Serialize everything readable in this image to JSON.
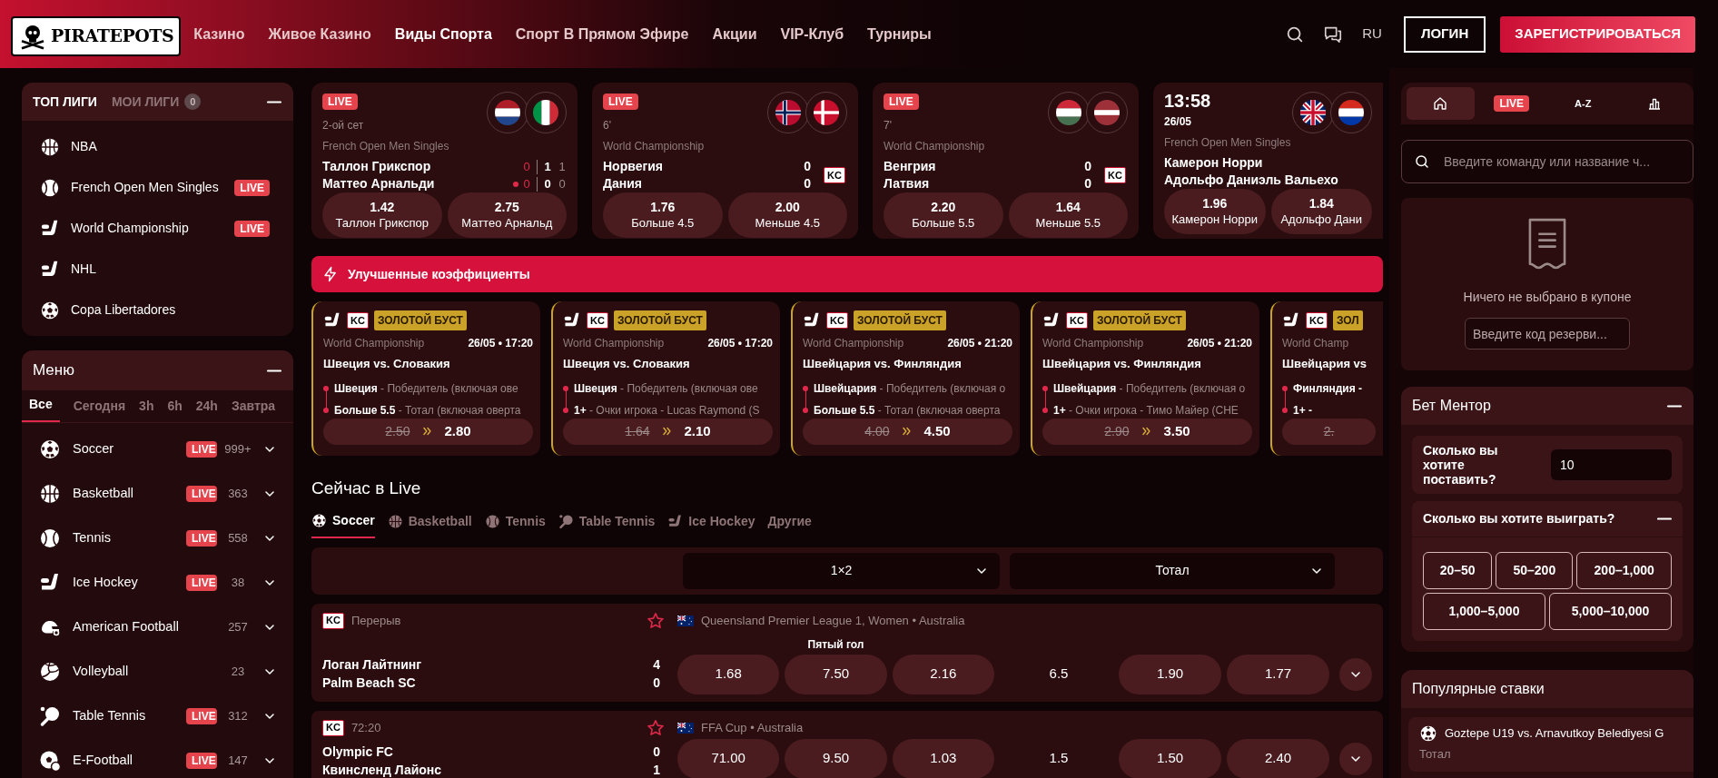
{
  "header": {
    "logo": "PIRATEPOTS",
    "nav": [
      {
        "label": "Казино",
        "selected": false
      },
      {
        "label": "Живое Казино",
        "selected": false
      },
      {
        "label": "Виды Спорта",
        "selected": true
      },
      {
        "label": "Спорт В Прямом Эфире",
        "selected": false
      },
      {
        "label": "Акции",
        "selected": false
      },
      {
        "label": "VIP-Клуб",
        "selected": false
      },
      {
        "label": "Турниры",
        "selected": false
      }
    ],
    "language": "RU",
    "login": "ЛОГИН",
    "register": "ЗАРЕГИСТРИРОВАТЬСЯ"
  },
  "top_leagues": {
    "tabs": [
      {
        "label": "ТОП ЛИГИ",
        "selected": true
      },
      {
        "label": "МОИ ЛИГИ",
        "selected": false,
        "count": "0"
      }
    ],
    "items": [
      {
        "kind": "basketball",
        "label": "NBA"
      },
      {
        "kind": "tennis",
        "label": "French Open Men Singles",
        "badge": "LIVE"
      },
      {
        "kind": "hockey",
        "label": "World Championship",
        "badge": "LIVE"
      },
      {
        "kind": "hockey",
        "label": "NHL"
      },
      {
        "kind": "soccer",
        "label": "Copa Libertadores"
      }
    ]
  },
  "menu": {
    "title": "Меню",
    "filters": [
      {
        "label": "Все",
        "selected": true
      },
      {
        "label": "Сегодня",
        "selected": false
      },
      {
        "label": "3h",
        "selected": false
      },
      {
        "label": "6h",
        "selected": false
      },
      {
        "label": "24h",
        "selected": false
      },
      {
        "label": "Завтра",
        "selected": false
      }
    ],
    "sports": [
      {
        "kind": "soccer",
        "label": "Soccer",
        "badge": "LIVE",
        "count": "999+"
      },
      {
        "kind": "basketball",
        "label": "Basketball",
        "badge": "LIVE",
        "count": "363"
      },
      {
        "kind": "tennis",
        "label": "Tennis",
        "badge": "LIVE",
        "count": "558"
      },
      {
        "kind": "hockey",
        "label": "Ice Hockey",
        "badge": "LIVE",
        "count": "38"
      },
      {
        "kind": "football",
        "label": "American Football",
        "count": "257"
      },
      {
        "kind": "volleyball",
        "label": "Volleyball",
        "count": "23"
      },
      {
        "kind": "tabletennis",
        "label": "Table Tennis",
        "badge": "LIVE",
        "count": "312"
      },
      {
        "kind": "efootball",
        "label": "E-Football",
        "badge": "LIVE",
        "count": "147"
      }
    ]
  },
  "featured_matches": [
    {
      "badge": "LIVE",
      "period": "2-ой сет",
      "league": "French Open Men Singles",
      "teams": [
        {
          "name": "Таллон Грикспор",
          "flag": {
            "kind": "netherlands"
          },
          "serving": false,
          "scores": [
            "0",
            "1",
            "1"
          ]
        },
        {
          "name": "Маттео Арнальди",
          "flag": {
            "kind": "italy"
          },
          "serving": true,
          "scores": [
            "0",
            "0",
            "0"
          ]
        }
      ],
      "odds": [
        {
          "value": "1.42",
          "label": "Таллон Грикспор"
        },
        {
          "value": "2.75",
          "label": "Маттео Арнальд"
        }
      ]
    },
    {
      "badge": "LIVE",
      "period": "6'",
      "league": "World Championship",
      "kc": "KC",
      "teams": [
        {
          "name": "Норвегия",
          "flag": {
            "kind": "norway"
          },
          "scores": [
            "0"
          ]
        },
        {
          "name": "Дания",
          "flag": {
            "kind": "denmark"
          },
          "scores": [
            "0"
          ]
        }
      ],
      "odds": [
        {
          "value": "1.76",
          "label": "Больше 4.5"
        },
        {
          "value": "2.00",
          "label": "Меньше 4.5"
        }
      ]
    },
    {
      "badge": "LIVE",
      "period": "7'",
      "league": "World Championship",
      "kc": "KC",
      "teams": [
        {
          "name": "Венгрия",
          "flag": {
            "kind": "hungary"
          },
          "scores": [
            "0"
          ]
        },
        {
          "name": "Латвия",
          "flag": {
            "kind": "latvia"
          },
          "scores": [
            "0"
          ]
        }
      ],
      "odds": [
        {
          "value": "2.20",
          "label": "Больше 5.5"
        },
        {
          "value": "1.64",
          "label": "Меньше 5.5"
        }
      ]
    },
    {
      "time": "13:58",
      "date": "26/05",
      "league": "French Open Men Singles",
      "teams": [
        {
          "name": "Камерон Норри",
          "flag": {
            "kind": "uk"
          }
        },
        {
          "name": "Адольфо Даниэль Вальехо",
          "flag": {
            "kind": "paraguay"
          }
        }
      ],
      "odds": [
        {
          "value": "1.96",
          "label": "Камерон Норри"
        },
        {
          "value": "1.84",
          "label": "Адольфо Дани"
        }
      ]
    }
  ],
  "boosted": {
    "title": "Улучшенные коэффициенты",
    "cards": [
      {
        "kind": "full",
        "kc": "KC",
        "tag": "ЗОЛОТОЙ БУСТ",
        "league": "World Championship",
        "datetime": "26/05 • 17:20",
        "match": "Швеция vs. Словакия",
        "legs": [
          {
            "pick": "Швеция",
            "market": "- Победитель (включая ове"
          },
          {
            "pick": "Больше 5.5",
            "market": "- Тотал (включая оверта"
          }
        ],
        "old_odds": "2.50",
        "new_odds": "2.80"
      },
      {
        "kind": "full",
        "kc": "KC",
        "tag": "ЗОЛОТОЙ БУСТ",
        "league": "World Championship",
        "datetime": "26/05 • 17:20",
        "match": "Швеция vs. Словакия",
        "legs": [
          {
            "pick": "Швеция",
            "market": "- Победитель (включая ове"
          },
          {
            "pick": "1+",
            "market": "- Очки игрока - Lucas Raymond (S"
          }
        ],
        "old_odds": "1.64",
        "new_odds": "2.10"
      },
      {
        "kind": "full",
        "kc": "KC",
        "tag": "ЗОЛОТОЙ БУСТ",
        "league": "World Championship",
        "datetime": "26/05 • 21:20",
        "match": "Швейцария vs. Финляндия",
        "legs": [
          {
            "pick": "Швейцария",
            "market": "- Победитель (включая о"
          },
          {
            "pick": "Больше 5.5",
            "market": "- Тотал (включая оверта"
          }
        ],
        "old_odds": "4.00",
        "new_odds": "4.50"
      },
      {
        "kind": "full",
        "kc": "KC",
        "tag": "ЗОЛОТОЙ БУСТ",
        "league": "World Championship",
        "datetime": "26/05 • 21:20",
        "match": "Швейцария vs. Финляндия",
        "legs": [
          {
            "pick": "Швейцария",
            "market": "- Победитель (включая о"
          },
          {
            "pick": "1+",
            "market": "- Очки игрока - Тимо Майер (CHE"
          }
        ],
        "old_odds": "2.90",
        "new_odds": "3.50"
      },
      {
        "kind": "partial",
        "kc": "KC",
        "tag": "ЗОЛ",
        "league": "World Champ",
        "match": "Швейцария vs",
        "legs": [
          {
            "pick": "Финляндия -"
          },
          {
            "pick": "1+ -"
          }
        ],
        "old_odds": "2."
      }
    ]
  },
  "live": {
    "title": "Сейчас в Live",
    "tabs": [
      {
        "kind": "soccer",
        "label": "Soccer",
        "selected": true
      },
      {
        "kind": "basketball",
        "label": "Basketball",
        "selected": false
      },
      {
        "kind": "tennis",
        "label": "Tennis",
        "selected": false
      },
      {
        "kind": "tabletennis",
        "label": "Table Tennis",
        "selected": false
      },
      {
        "kind": "hockey",
        "label": "Ice Hockey",
        "selected": false
      },
      {
        "label": "Другие",
        "selected": false
      }
    ],
    "markets": [
      "1×2",
      "Тотал"
    ],
    "events": [
      {
        "kc": "KC",
        "status": "Перерыв",
        "favorite": false,
        "flag": {
          "kind": "australia"
        },
        "league": "Queensland Premier League 1, Women • Australia",
        "market_label": "Пятый гол",
        "teams": [
          {
            "name": "Логан Лайтнинг",
            "score": "4"
          },
          {
            "name": "Palm Beach SC",
            "score": "0"
          }
        ],
        "odds_1x2": [
          "1.68",
          "7.50",
          "2.16"
        ],
        "total_line": "6.5",
        "odds_total": [
          "1.90",
          "1.77"
        ]
      },
      {
        "kc": "KC",
        "status": "72:20",
        "favorite": false,
        "flag": {
          "kind": "australia"
        },
        "league": "FFA Cup • Australia",
        "teams": [
          {
            "name": "Olympic FC",
            "score": "0"
          },
          {
            "name": "Квинсленд Лайонс",
            "score": "1"
          }
        ],
        "odds_1x2": [
          "71.00",
          "9.50",
          "1.03"
        ],
        "total_line": "1.5",
        "odds_total": [
          "1.50",
          "2.40"
        ]
      }
    ]
  },
  "betslip": {
    "tabs": [
      {
        "kind": "home",
        "selected": true
      },
      {
        "kind": "live",
        "label": "LIVE",
        "selected": false
      },
      {
        "kind": "az",
        "label": "A-Z",
        "selected": false
      },
      {
        "kind": "stats",
        "selected": false
      }
    ],
    "search_placeholder": "Введите команду или название ч...",
    "empty_text": "Ничего не выбрано в купоне",
    "code_placeholder": "Введите код резерви..."
  },
  "bet_mentor": {
    "title": "Бет Ментор",
    "stake_label": "Сколько вы хотите поставить?",
    "stake_value": "10",
    "win_label": "Сколько вы хотите выиграть?",
    "ranges": [
      "20–50",
      "50–200",
      "200–1,000",
      "1,000–5,000",
      "5,000–10,000"
    ]
  },
  "popular": {
    "title": "Популярные ставки",
    "items": [
      {
        "kind": "soccer",
        "match": "Goztepe U19 vs. Arnavutkoy Belediyesi G",
        "market": "Тотал"
      }
    ]
  }
}
